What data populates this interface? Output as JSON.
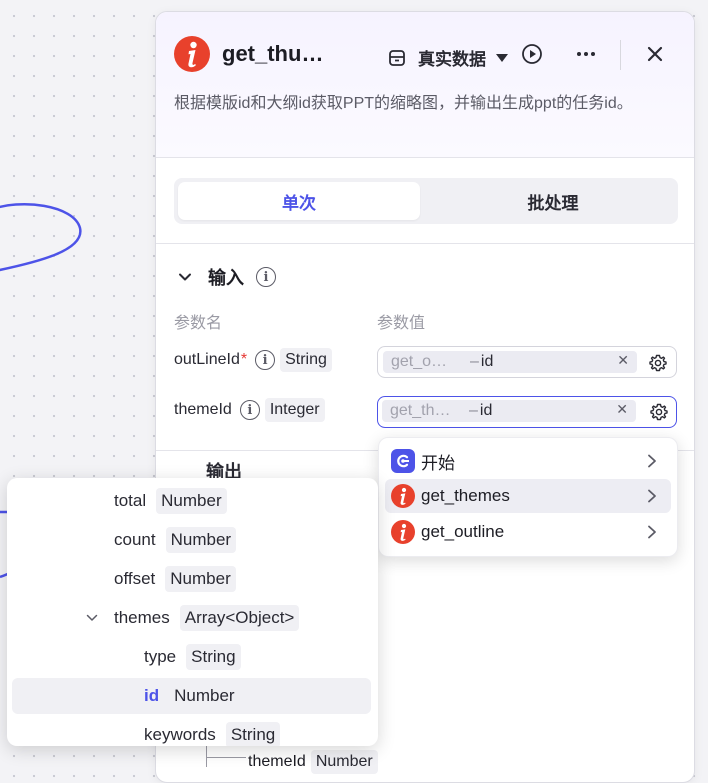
{
  "node": {
    "title": "get_thu…",
    "mode_label": "真实数据",
    "description": "根据模版id和大纲id获取PPT的缩略图，并输出生成ppt的任务id。"
  },
  "tabs": {
    "single": "单次",
    "batch": "批处理"
  },
  "input_section": {
    "title": "输入",
    "col_name": "参数名",
    "col_value": "参数值",
    "params": [
      {
        "name": "outLineId",
        "required_mark": "*",
        "type": "String",
        "ref_node": "get_o…",
        "ref_dash": "–",
        "ref_field": "id"
      },
      {
        "name": "themeId",
        "required_mark": "",
        "type": "Integer",
        "ref_node": "get_th…",
        "ref_dash": "–",
        "ref_field": "id"
      }
    ]
  },
  "output_section": {
    "title": "输出",
    "child_name": "themeId",
    "child_type": "Number"
  },
  "dropdown": {
    "items": [
      {
        "label": "开始",
        "icon": "start-node-icon"
      },
      {
        "label": "get_themes",
        "icon": "plugin-node-icon"
      },
      {
        "label": "get_outline",
        "icon": "plugin-node-icon"
      }
    ]
  },
  "popover": {
    "rows": [
      {
        "name": "total",
        "type": "Number"
      },
      {
        "name": "count",
        "type": "Number"
      },
      {
        "name": "offset",
        "type": "Number"
      },
      {
        "name": "themes",
        "type": "Array<Object>"
      },
      {
        "name": "type",
        "type": "String"
      },
      {
        "name": "id",
        "type": "Number"
      },
      {
        "name": "keywords",
        "type": "String"
      }
    ]
  },
  "colors": {
    "accent": "#4d53e8",
    "plugin_red": "#e8412c"
  }
}
